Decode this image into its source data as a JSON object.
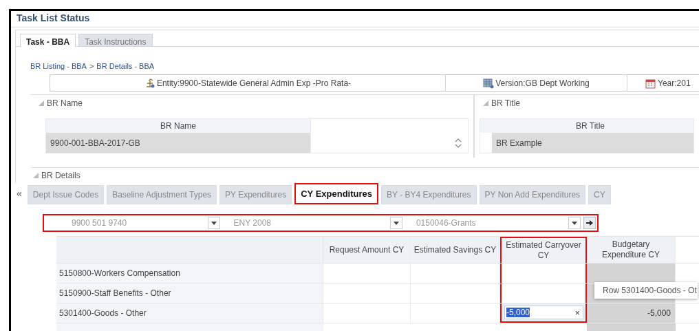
{
  "window": {
    "title": "Task List Status"
  },
  "tabs": [
    {
      "label": "Task - BBA",
      "selected": true
    },
    {
      "label": "Task Instructions",
      "selected": false
    }
  ],
  "breadcrumb": {
    "items": [
      "BR Listing - BBA",
      "BR Details - BBA"
    ],
    "separator": ">"
  },
  "pov_bar": [
    {
      "kind": "entity",
      "label": "Entity:9900-Statewide General Admin Exp -Pro Rata-"
    },
    {
      "kind": "version",
      "label": "Version:GB Dept Working"
    },
    {
      "kind": "year",
      "label": "Year:201"
    }
  ],
  "br_name_panel": {
    "title": "BR Name",
    "column": "BR Name",
    "value": "9900-001-BBA-2017-GB"
  },
  "br_title_panel": {
    "title": "BR Title",
    "column": "BR Title",
    "value": "BR Example"
  },
  "details": {
    "title": "BR Details",
    "scroll_left": "«",
    "tabs": [
      {
        "label": "Dept Issue Codes",
        "selected": false,
        "highlighted": false
      },
      {
        "label": "Baseline Adjustment Types",
        "selected": false,
        "highlighted": false
      },
      {
        "label": "PY Expenditures",
        "selected": false,
        "highlighted": false
      },
      {
        "label": "CY Expenditures",
        "selected": true,
        "highlighted": true
      },
      {
        "label": "BY - BY4 Expenditures",
        "selected": false,
        "highlighted": false
      },
      {
        "label": "PY Non Add Expenditures",
        "selected": false,
        "highlighted": false
      },
      {
        "label": "CY",
        "selected": false,
        "highlighted": false
      }
    ]
  },
  "filters": {
    "highlighted": true,
    "dropdowns": [
      {
        "value": "9900 501 9740"
      },
      {
        "value": "ENY 2008"
      },
      {
        "value": "0150046-Grants"
      }
    ]
  },
  "grid": {
    "columns": [
      {
        "label": "Request Amount CY",
        "highlighted": false
      },
      {
        "label": "Estimated Savings CY",
        "highlighted": false
      },
      {
        "label": "Estimated Carryover CY",
        "highlighted": true
      },
      {
        "label": "Budgetary Expenditure CY",
        "highlighted": false
      }
    ],
    "rows": [
      {
        "label": "5150800-Workers Compensation",
        "cells": [
          {
            "kind": "blank"
          },
          {
            "kind": "blank"
          },
          {
            "kind": "blank"
          },
          {
            "kind": "readonly"
          }
        ]
      },
      {
        "label": "5150900-Staff Benefits - Other",
        "cells": [
          {
            "kind": "blank"
          },
          {
            "kind": "blank"
          },
          {
            "kind": "blank"
          },
          {
            "kind": "readonly"
          }
        ]
      },
      {
        "label": "5301400-Goods - Other",
        "cells": [
          {
            "kind": "blank"
          },
          {
            "kind": "blank"
          },
          {
            "kind": "input",
            "value": "-5,000",
            "clear": "×"
          },
          {
            "kind": "readonly",
            "value": "-5,000"
          }
        ]
      }
    ]
  },
  "tooltip": {
    "text": "Row 5301400-Goods - Ot"
  }
}
